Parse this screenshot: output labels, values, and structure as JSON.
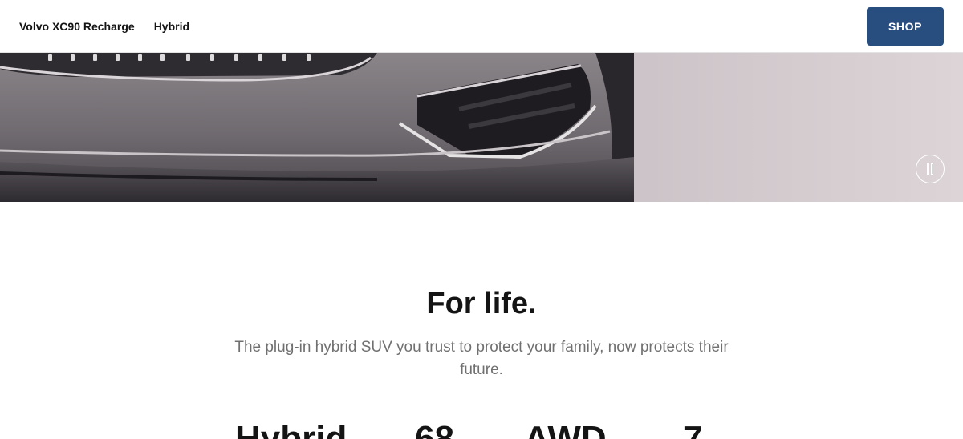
{
  "nav": {
    "model_name": "Volvo XC90 Recharge",
    "variant_link": "Hybrid",
    "shop_label": "SHOP"
  },
  "hero": {
    "pause_control": "pause-icon"
  },
  "intro": {
    "headline": "For life.",
    "description": "The plug-in hybrid SUV you trust to protect your family, now protects their future."
  },
  "stats": [
    {
      "value": "Hybrid"
    },
    {
      "value": "68"
    },
    {
      "value": "AWD"
    },
    {
      "value": "7"
    }
  ],
  "colors": {
    "shop_button": "#284e80",
    "headline_text": "#141414",
    "body_text": "#707070"
  }
}
